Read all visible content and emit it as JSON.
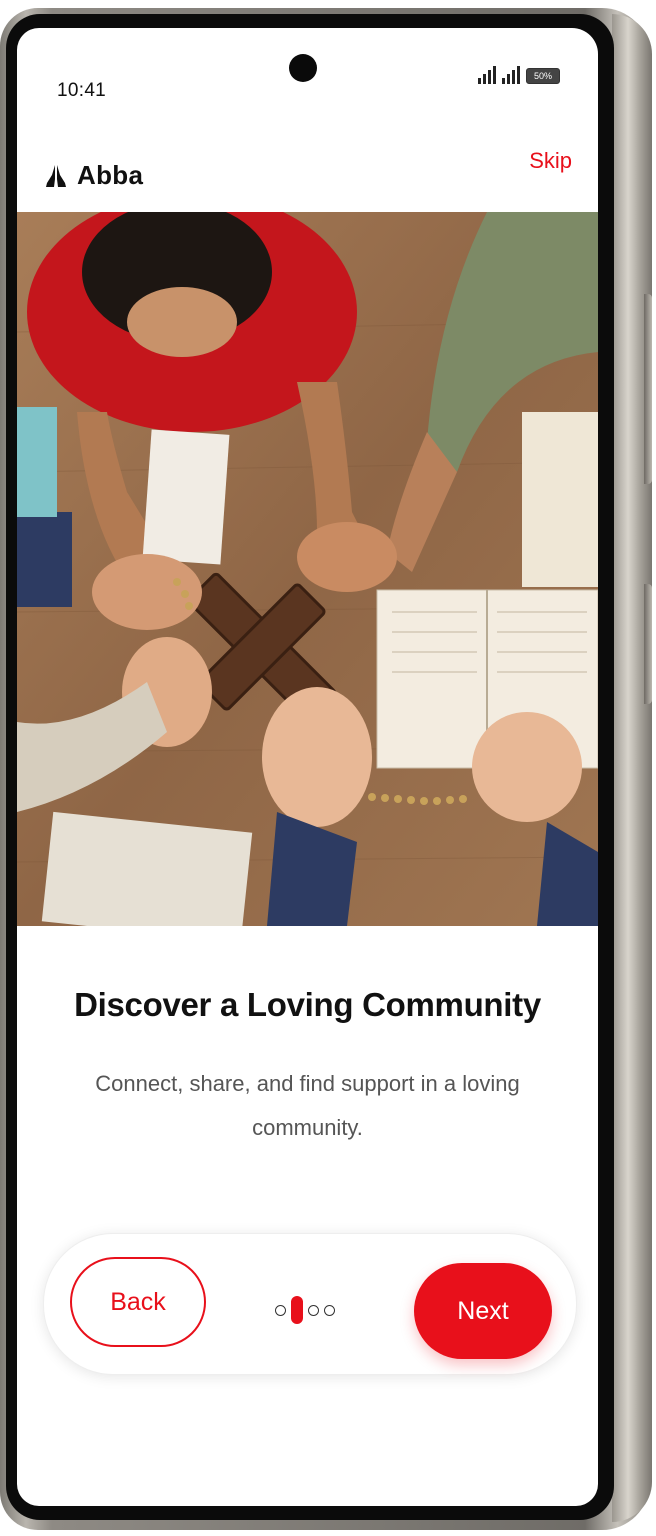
{
  "status_bar": {
    "time": "10:41",
    "battery": "50%"
  },
  "header": {
    "app_name": "Abba",
    "skip_label": "Skip",
    "logo_icon": "praying-hands-icon"
  },
  "onboarding": {
    "title": "Discover a Loving Community",
    "subtitle": "Connect, share, and find support in a loving community.",
    "current_step": 2,
    "total_steps": 4
  },
  "nav": {
    "back_label": "Back",
    "next_label": "Next"
  },
  "colors": {
    "accent": "#e8101b",
    "text": "#111111",
    "muted": "#555555"
  }
}
